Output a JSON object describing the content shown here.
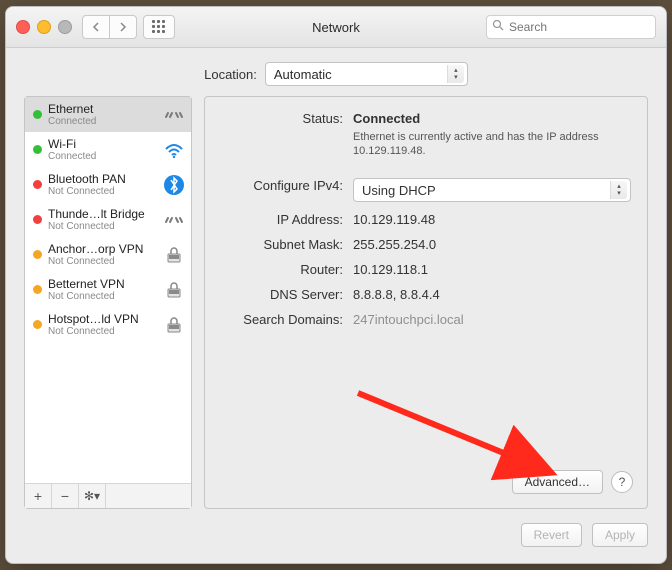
{
  "window": {
    "title": "Network"
  },
  "toolbar": {
    "search_placeholder": "Search"
  },
  "location": {
    "label": "Location:",
    "value": "Automatic"
  },
  "services": [
    {
      "name": "Ethernet",
      "status": "Connected",
      "dot": "green",
      "icon": "ethernet",
      "selected": true
    },
    {
      "name": "Wi-Fi",
      "status": "Connected",
      "dot": "green",
      "icon": "wifi",
      "selected": false
    },
    {
      "name": "Bluetooth PAN",
      "status": "Not Connected",
      "dot": "red",
      "icon": "bluetooth",
      "selected": false
    },
    {
      "name": "Thunde…lt Bridge",
      "status": "Not Connected",
      "dot": "red",
      "icon": "ethernet",
      "selected": false
    },
    {
      "name": "Anchor…orp VPN",
      "status": "Not Connected",
      "dot": "orange",
      "icon": "vpn",
      "selected": false
    },
    {
      "name": "Betternet VPN",
      "status": "Not Connected",
      "dot": "orange",
      "icon": "vpn",
      "selected": false
    },
    {
      "name": "Hotspot…ld VPN",
      "status": "Not Connected",
      "dot": "orange",
      "icon": "vpn",
      "selected": false
    }
  ],
  "details": {
    "status_label": "Status:",
    "status_value": "Connected",
    "status_note": "Ethernet is currently active and has the IP address 10.129.119.48.",
    "configure_label": "Configure IPv4:",
    "configure_value": "Using DHCP",
    "ip_label": "IP Address:",
    "ip_value": "10.129.119.48",
    "subnet_label": "Subnet Mask:",
    "subnet_value": "255.255.254.0",
    "router_label": "Router:",
    "router_value": "10.129.118.1",
    "dns_label": "DNS Server:",
    "dns_value": "8.8.8.8, 8.8.4.4",
    "search_label": "Search Domains:",
    "search_value": "247intouchpci.local"
  },
  "buttons": {
    "advanced": "Advanced…",
    "help": "?",
    "revert": "Revert",
    "apply": "Apply"
  },
  "colors": {
    "arrow": "#ff2a1c"
  }
}
